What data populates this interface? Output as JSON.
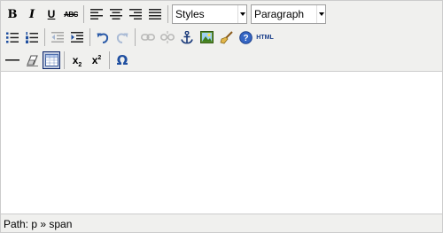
{
  "toolbar": {
    "bold_glyph": "B",
    "italic_glyph": "I",
    "underline_glyph": "U",
    "strike_glyph": "ABC",
    "styles_value": "Styles",
    "format_value": "Paragraph",
    "html_glyph": "HTML",
    "subscript_glyph": "x",
    "subscript_mark": "2",
    "superscript_glyph": "x",
    "superscript_mark": "2",
    "charmap_glyph": "Ω",
    "icons": [
      "bold-icon",
      "italic-icon",
      "underline-icon",
      "strikethrough-icon",
      "align-left-icon",
      "align-center-icon",
      "align-right-icon",
      "align-justify-icon",
      "bullet-list-icon",
      "numbered-list-icon",
      "outdent-icon",
      "indent-icon",
      "undo-icon",
      "redo-icon",
      "link-icon",
      "unlink-icon",
      "anchor-icon",
      "image-icon",
      "cleanup-icon",
      "help-icon",
      "html-source-icon",
      "horizontal-rule-icon",
      "remove-format-icon",
      "visual-aid-icon",
      "subscript-icon",
      "superscript-icon",
      "special-character-icon"
    ]
  },
  "status": {
    "path_text": "Path: p » span"
  },
  "colors": {
    "toolbar_bg": "#f0f0ee",
    "border": "#cccccc",
    "active_border": "#0a246a",
    "active_bg": "#c2cbe0",
    "icon_blue": "#1f4fa0"
  }
}
